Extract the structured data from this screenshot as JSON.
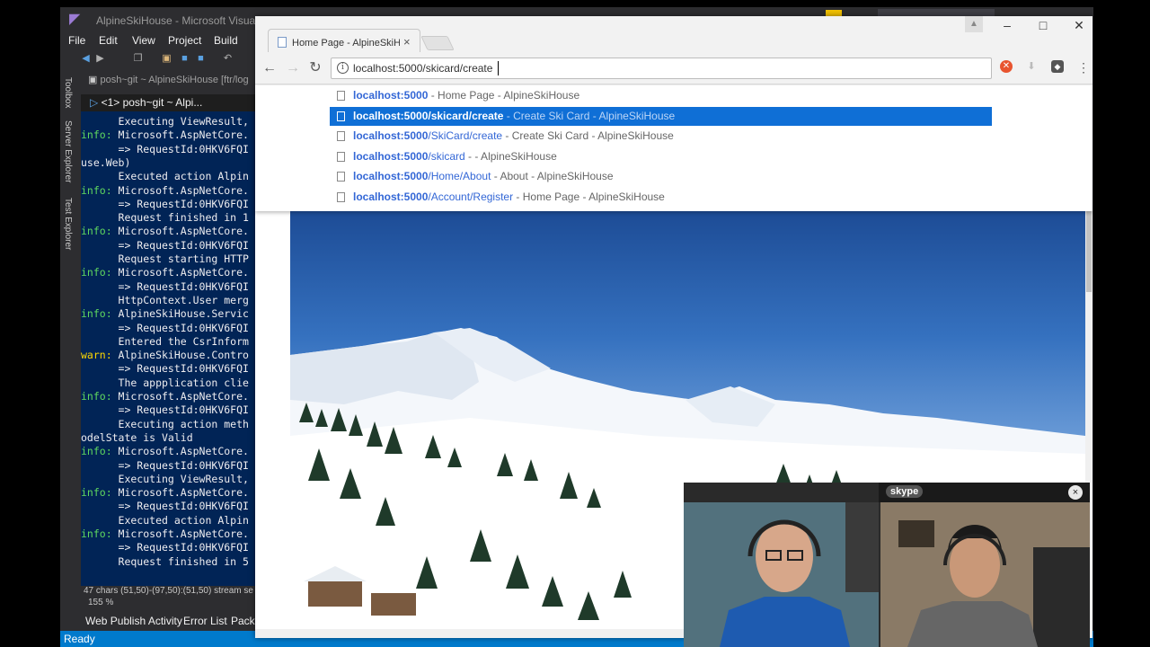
{
  "vs": {
    "title": "AlpineSkiHouse - Microsoft Visual St",
    "menu": [
      "File",
      "Edit",
      "View",
      "Project",
      "Build"
    ],
    "side_tabs": [
      "Toolbox",
      "Server Explorer",
      "Test Explorer"
    ],
    "doc_tab": "posh~git ~ AlpineSkiHouse [ftr/log",
    "terminal_tab": "<1> posh~git ~ Alpi...",
    "console_lines": [
      {
        "lvl": "",
        "text": "      Executing ViewResult,"
      },
      {
        "lvl": "info:",
        "text": " Microsoft.AspNetCore."
      },
      {
        "lvl": "",
        "text": "      => RequestId:0HKV6FQI"
      },
      {
        "lvl": "",
        "text": "use.Web)"
      },
      {
        "lvl": "",
        "text": "      Executed action Alpin"
      },
      {
        "lvl": "info:",
        "text": " Microsoft.AspNetCore."
      },
      {
        "lvl": "",
        "text": "      => RequestId:0HKV6FQI"
      },
      {
        "lvl": "",
        "text": "      Request finished in 1"
      },
      {
        "lvl": "info:",
        "text": " Microsoft.AspNetCore."
      },
      {
        "lvl": "",
        "text": "      => RequestId:0HKV6FQI"
      },
      {
        "lvl": "",
        "text": "      Request starting HTTP"
      },
      {
        "lvl": "info:",
        "text": " Microsoft.AspNetCore."
      },
      {
        "lvl": "",
        "text": "      => RequestId:0HKV6FQI"
      },
      {
        "lvl": "",
        "text": "      HttpContext.User merg"
      },
      {
        "lvl": "info:",
        "text": " AlpineSkiHouse.Servic"
      },
      {
        "lvl": "",
        "text": "      => RequestId:0HKV6FQI"
      },
      {
        "lvl": "",
        "text": "      Entered the CsrInform"
      },
      {
        "lvl": "warn:",
        "text": " AlpineSkiHouse.Contro"
      },
      {
        "lvl": "",
        "text": "      => RequestId:0HKV6FQI"
      },
      {
        "lvl": "",
        "text": "      The appplication clie"
      },
      {
        "lvl": "info:",
        "text": " Microsoft.AspNetCore."
      },
      {
        "lvl": "",
        "text": "      => RequestId:0HKV6FQI"
      },
      {
        "lvl": "",
        "text": "      Executing action meth"
      },
      {
        "lvl": "",
        "text": "odelState is Valid"
      },
      {
        "lvl": "info:",
        "text": " Microsoft.AspNetCore."
      },
      {
        "lvl": "",
        "text": "      => RequestId:0HKV6FQI"
      },
      {
        "lvl": "",
        "text": "      Executing ViewResult,"
      },
      {
        "lvl": "info:",
        "text": " Microsoft.AspNetCore."
      },
      {
        "lvl": "",
        "text": "      => RequestId:0HKV6FQI"
      },
      {
        "lvl": "",
        "text": "      Executed action Alpin"
      },
      {
        "lvl": "info:",
        "text": " Microsoft.AspNetCore."
      },
      {
        "lvl": "",
        "text": "      => RequestId:0HKV6FQI"
      },
      {
        "lvl": "",
        "text": "      Request finished in 5"
      }
    ],
    "status_info": "47 chars (51,50)-(97,50):(51,50) stream se",
    "zoom": "155 %",
    "bottom_tabs": [
      "Web Publish Activity",
      "Error List",
      "Packa"
    ],
    "status_ready": "Ready",
    "colors": {
      "statusbar": "#007acc",
      "console_bg": "#012456",
      "info": "#5fd75f",
      "warn": "#ffd700"
    }
  },
  "chrome": {
    "tab_title": "Home Page - AlpineSkiH",
    "tab_close": "×",
    "url": "localhost:5000/skicard/create",
    "suggestions": [
      {
        "host": "localhost:5000",
        "path": "",
        "title": "Home Page - AlpineSkiHouse",
        "selected": false
      },
      {
        "host": "localhost:5000",
        "path": "/skicard/create",
        "title": "Create Ski Card - AlpineSkiHouse",
        "selected": true
      },
      {
        "host": "localhost:5000",
        "path": "/SkiCard/create",
        "title": "Create Ski Card - AlpineSkiHouse",
        "selected": false
      },
      {
        "host": "localhost:5000",
        "path": "/skicard",
        "title": "- AlpineSkiHouse",
        "selected": false
      },
      {
        "host": "localhost:5000",
        "path": "/Home/About",
        "title": "About - AlpineSkiHouse",
        "selected": false
      },
      {
        "host": "localhost:5000",
        "path": "/Account/Register",
        "title": "Home Page - AlpineSkiHouse",
        "selected": false
      }
    ],
    "colors": {
      "selected": "#0f6fd6",
      "url_link": "#3367d6"
    }
  },
  "skype": {
    "logo": "skype",
    "close": "×"
  }
}
